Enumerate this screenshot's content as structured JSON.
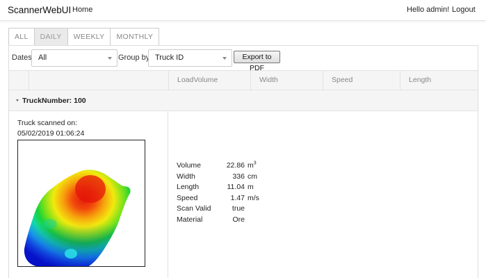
{
  "nav": {
    "brand": "ScannerWebUI",
    "home": "Home",
    "greeting": "Hello admin!",
    "logout": "Logout"
  },
  "tabs": [
    {
      "label": "ALL",
      "active": false
    },
    {
      "label": "DAILY",
      "active": true
    },
    {
      "label": "WEEKLY",
      "active": false
    },
    {
      "label": "MONTHLY",
      "active": false
    }
  ],
  "filters": {
    "dates_label": "Dates:",
    "dates_value": "All",
    "group_label": "Group by:",
    "group_value": "Truck ID",
    "export_label": "Export to PDF"
  },
  "table": {
    "columns": [
      "LoadVolume",
      "Width",
      "Speed",
      "Length"
    ]
  },
  "group": {
    "title": "TruckNumber: 100"
  },
  "record": {
    "scan_label": "Truck scanned on:",
    "scan_date": "05/02/2019 01:06:24",
    "metrics": [
      {
        "name": "Volume",
        "value": "22.86",
        "unit": "m",
        "unit_sup": "3"
      },
      {
        "name": "Width",
        "value": "336",
        "unit": "cm",
        "unit_sup": ""
      },
      {
        "name": "Length",
        "value": "11.04",
        "unit": "m",
        "unit_sup": ""
      },
      {
        "name": "Speed",
        "value": "1.47",
        "unit": "m/s",
        "unit_sup": ""
      },
      {
        "name": "Scan Valid",
        "value": "true",
        "unit": "",
        "unit_sup": ""
      },
      {
        "name": "Material",
        "value": "Ore",
        "unit": "",
        "unit_sup": ""
      }
    ]
  }
}
